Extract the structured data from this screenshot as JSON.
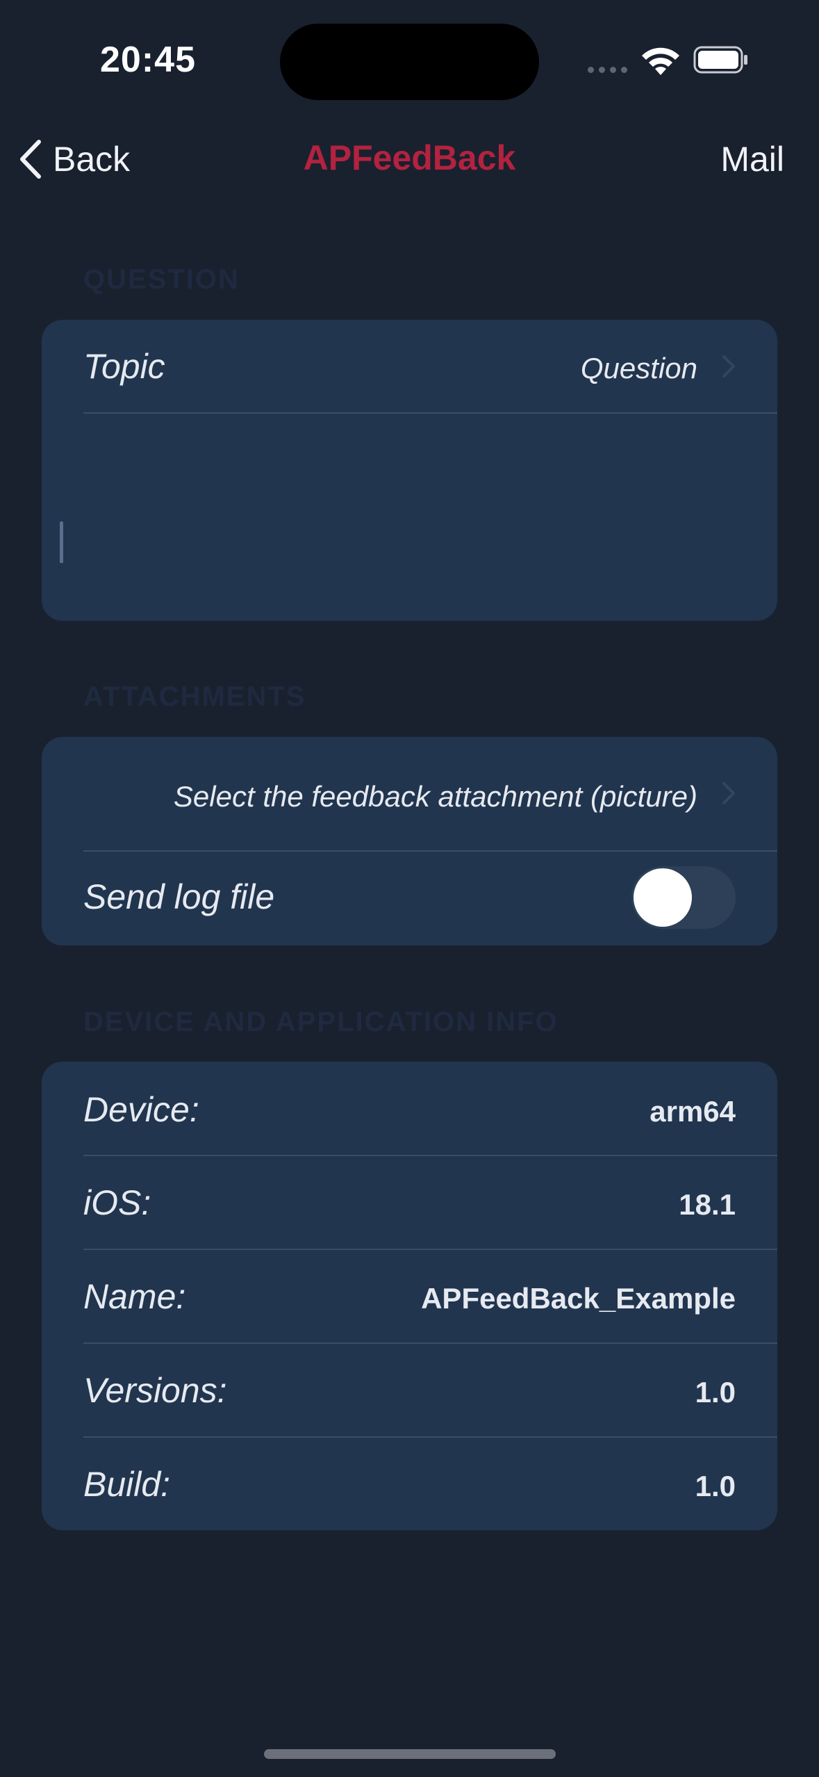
{
  "status_bar": {
    "time": "20:45"
  },
  "nav": {
    "back_label": "Back",
    "title": "APFeedBack",
    "right_action": "Mail"
  },
  "sections": {
    "question": {
      "header": "QUESTION",
      "topic_label": "Topic",
      "topic_value": "Question",
      "message_text": ""
    },
    "attachments": {
      "header": "ATTACHMENTS",
      "select_label": "Select the feedback attachment (picture)",
      "send_log_label": "Send log file",
      "send_log_enabled": false
    },
    "info": {
      "header": "DEVICE AND APPLICATION INFO",
      "rows": [
        {
          "label": "Device:",
          "value": "arm64"
        },
        {
          "label": "iOS:",
          "value": "18.1"
        },
        {
          "label": "Name:",
          "value": "APFeedBack_Example"
        },
        {
          "label": "Versions:",
          "value": "1.0"
        },
        {
          "label": "Build:",
          "value": "1.0"
        }
      ]
    }
  },
  "colors": {
    "background": "#19212f",
    "card": "#22354f",
    "accent_title": "#b3223f"
  }
}
